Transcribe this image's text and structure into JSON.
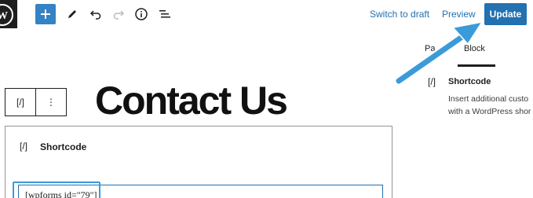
{
  "toolbar": {
    "add_block_icon": "plus-icon",
    "tools_icon": "pencil-icon",
    "undo_icon": "undo-icon",
    "redo_icon": "redo-icon",
    "details_icon": "info-icon",
    "list_view_icon": "list-view-icon"
  },
  "header_actions": {
    "switch_to_draft": "Switch to draft",
    "preview": "Preview",
    "update": "Update"
  },
  "sidebar": {
    "tabs": [
      {
        "label": "Pa"
      },
      {
        "label": "Block"
      }
    ],
    "active_tab": "Block",
    "block_icon": "[/]",
    "block_title": "Shortcode",
    "block_description": "Insert additional custo with a WordPress shor"
  },
  "block_toolbar": {
    "block_icon": "[/]",
    "options_icon": "⋮"
  },
  "editor": {
    "page_title": "Contact Us"
  },
  "shortcode_block": {
    "icon": "[/]",
    "label": "Shortcode",
    "value": "[wpforms id=\"79\"]"
  },
  "colors": {
    "primary": "#2271b1",
    "annotation_arrow": "#3b9bd9"
  }
}
